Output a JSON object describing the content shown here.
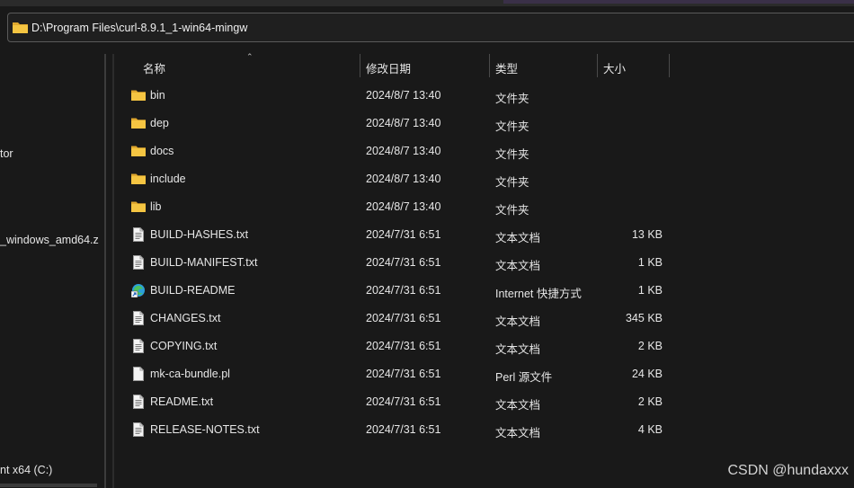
{
  "address": {
    "path": "D:\\Program Files\\curl-8.9.1_1-win64-mingw"
  },
  "sidebar": {
    "items": [
      {
        "label": "tor"
      },
      {
        "label": "_windows_amd64.z"
      },
      {
        "label": "nt x64 (C:)"
      }
    ]
  },
  "columns": {
    "name": "名称",
    "date": "修改日期",
    "type": "类型",
    "size": "大小"
  },
  "files": [
    {
      "name": "bin",
      "date": "2024/8/7 13:40",
      "type": "文件夹",
      "size": "",
      "icon": "folder-icon"
    },
    {
      "name": "dep",
      "date": "2024/8/7 13:40",
      "type": "文件夹",
      "size": "",
      "icon": "folder-icon"
    },
    {
      "name": "docs",
      "date": "2024/8/7 13:40",
      "type": "文件夹",
      "size": "",
      "icon": "folder-icon"
    },
    {
      "name": "include",
      "date": "2024/8/7 13:40",
      "type": "文件夹",
      "size": "",
      "icon": "folder-icon"
    },
    {
      "name": "lib",
      "date": "2024/8/7 13:40",
      "type": "文件夹",
      "size": "",
      "icon": "folder-icon"
    },
    {
      "name": "BUILD-HASHES.txt",
      "date": "2024/7/31 6:51",
      "type": "文本文档",
      "size": "13 KB",
      "icon": "text-file-icon"
    },
    {
      "name": "BUILD-MANIFEST.txt",
      "date": "2024/7/31 6:51",
      "type": "文本文档",
      "size": "1 KB",
      "icon": "text-file-icon"
    },
    {
      "name": "BUILD-README",
      "date": "2024/7/31 6:51",
      "type": "Internet 快捷方式",
      "size": "1 KB",
      "icon": "edge-shortcut-icon"
    },
    {
      "name": "CHANGES.txt",
      "date": "2024/7/31 6:51",
      "type": "文本文档",
      "size": "345 KB",
      "icon": "text-file-icon"
    },
    {
      "name": "COPYING.txt",
      "date": "2024/7/31 6:51",
      "type": "文本文档",
      "size": "2 KB",
      "icon": "text-file-icon"
    },
    {
      "name": "mk-ca-bundle.pl",
      "date": "2024/7/31 6:51",
      "type": "Perl 源文件",
      "size": "24 KB",
      "icon": "blank-file-icon"
    },
    {
      "name": "README.txt",
      "date": "2024/7/31 6:51",
      "type": "文本文档",
      "size": "2 KB",
      "icon": "text-file-icon"
    },
    {
      "name": "RELEASE-NOTES.txt",
      "date": "2024/7/31 6:51",
      "type": "文本文档",
      "size": "4 KB",
      "icon": "text-file-icon"
    }
  ],
  "watermark": "CSDN @hundaxxx",
  "colors": {
    "background": "#191919",
    "folder": "#f2c14e",
    "edge": "#2b9fd9",
    "text": "#e6e6e6"
  }
}
